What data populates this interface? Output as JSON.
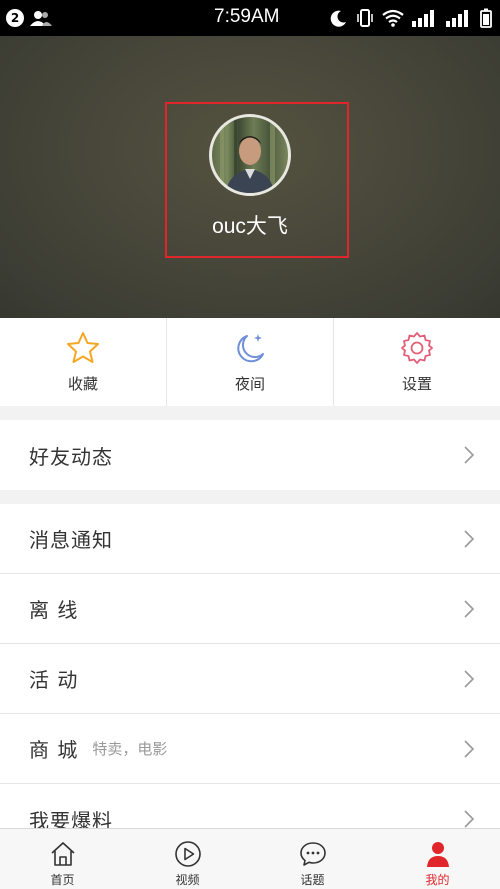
{
  "status_bar": {
    "notification_count": "2",
    "time": "7:59AM"
  },
  "profile": {
    "username": "ouc大飞"
  },
  "quick_actions": [
    {
      "label": "收藏",
      "icon": "star-icon",
      "color": "#f5a623"
    },
    {
      "label": "夜间",
      "icon": "moon-icon",
      "color": "#6f8fd8"
    },
    {
      "label": "设置",
      "icon": "gear-icon",
      "color": "#e2607a"
    }
  ],
  "menu": {
    "friends_activity": "好友动态",
    "messages": "消息通知",
    "offline": "离 线",
    "events": "活 动",
    "shop": "商 城",
    "shop_sub": "特卖，电影",
    "report": "我要爆料"
  },
  "tabs": [
    {
      "label": "首页",
      "icon": "home-icon"
    },
    {
      "label": "视频",
      "icon": "video-play-icon"
    },
    {
      "label": "话题",
      "icon": "chat-bubble-icon"
    },
    {
      "label": "我的",
      "icon": "profile-icon",
      "active": true
    }
  ],
  "colors": {
    "accent": "#e0262b",
    "header_bg": "#45453a"
  }
}
